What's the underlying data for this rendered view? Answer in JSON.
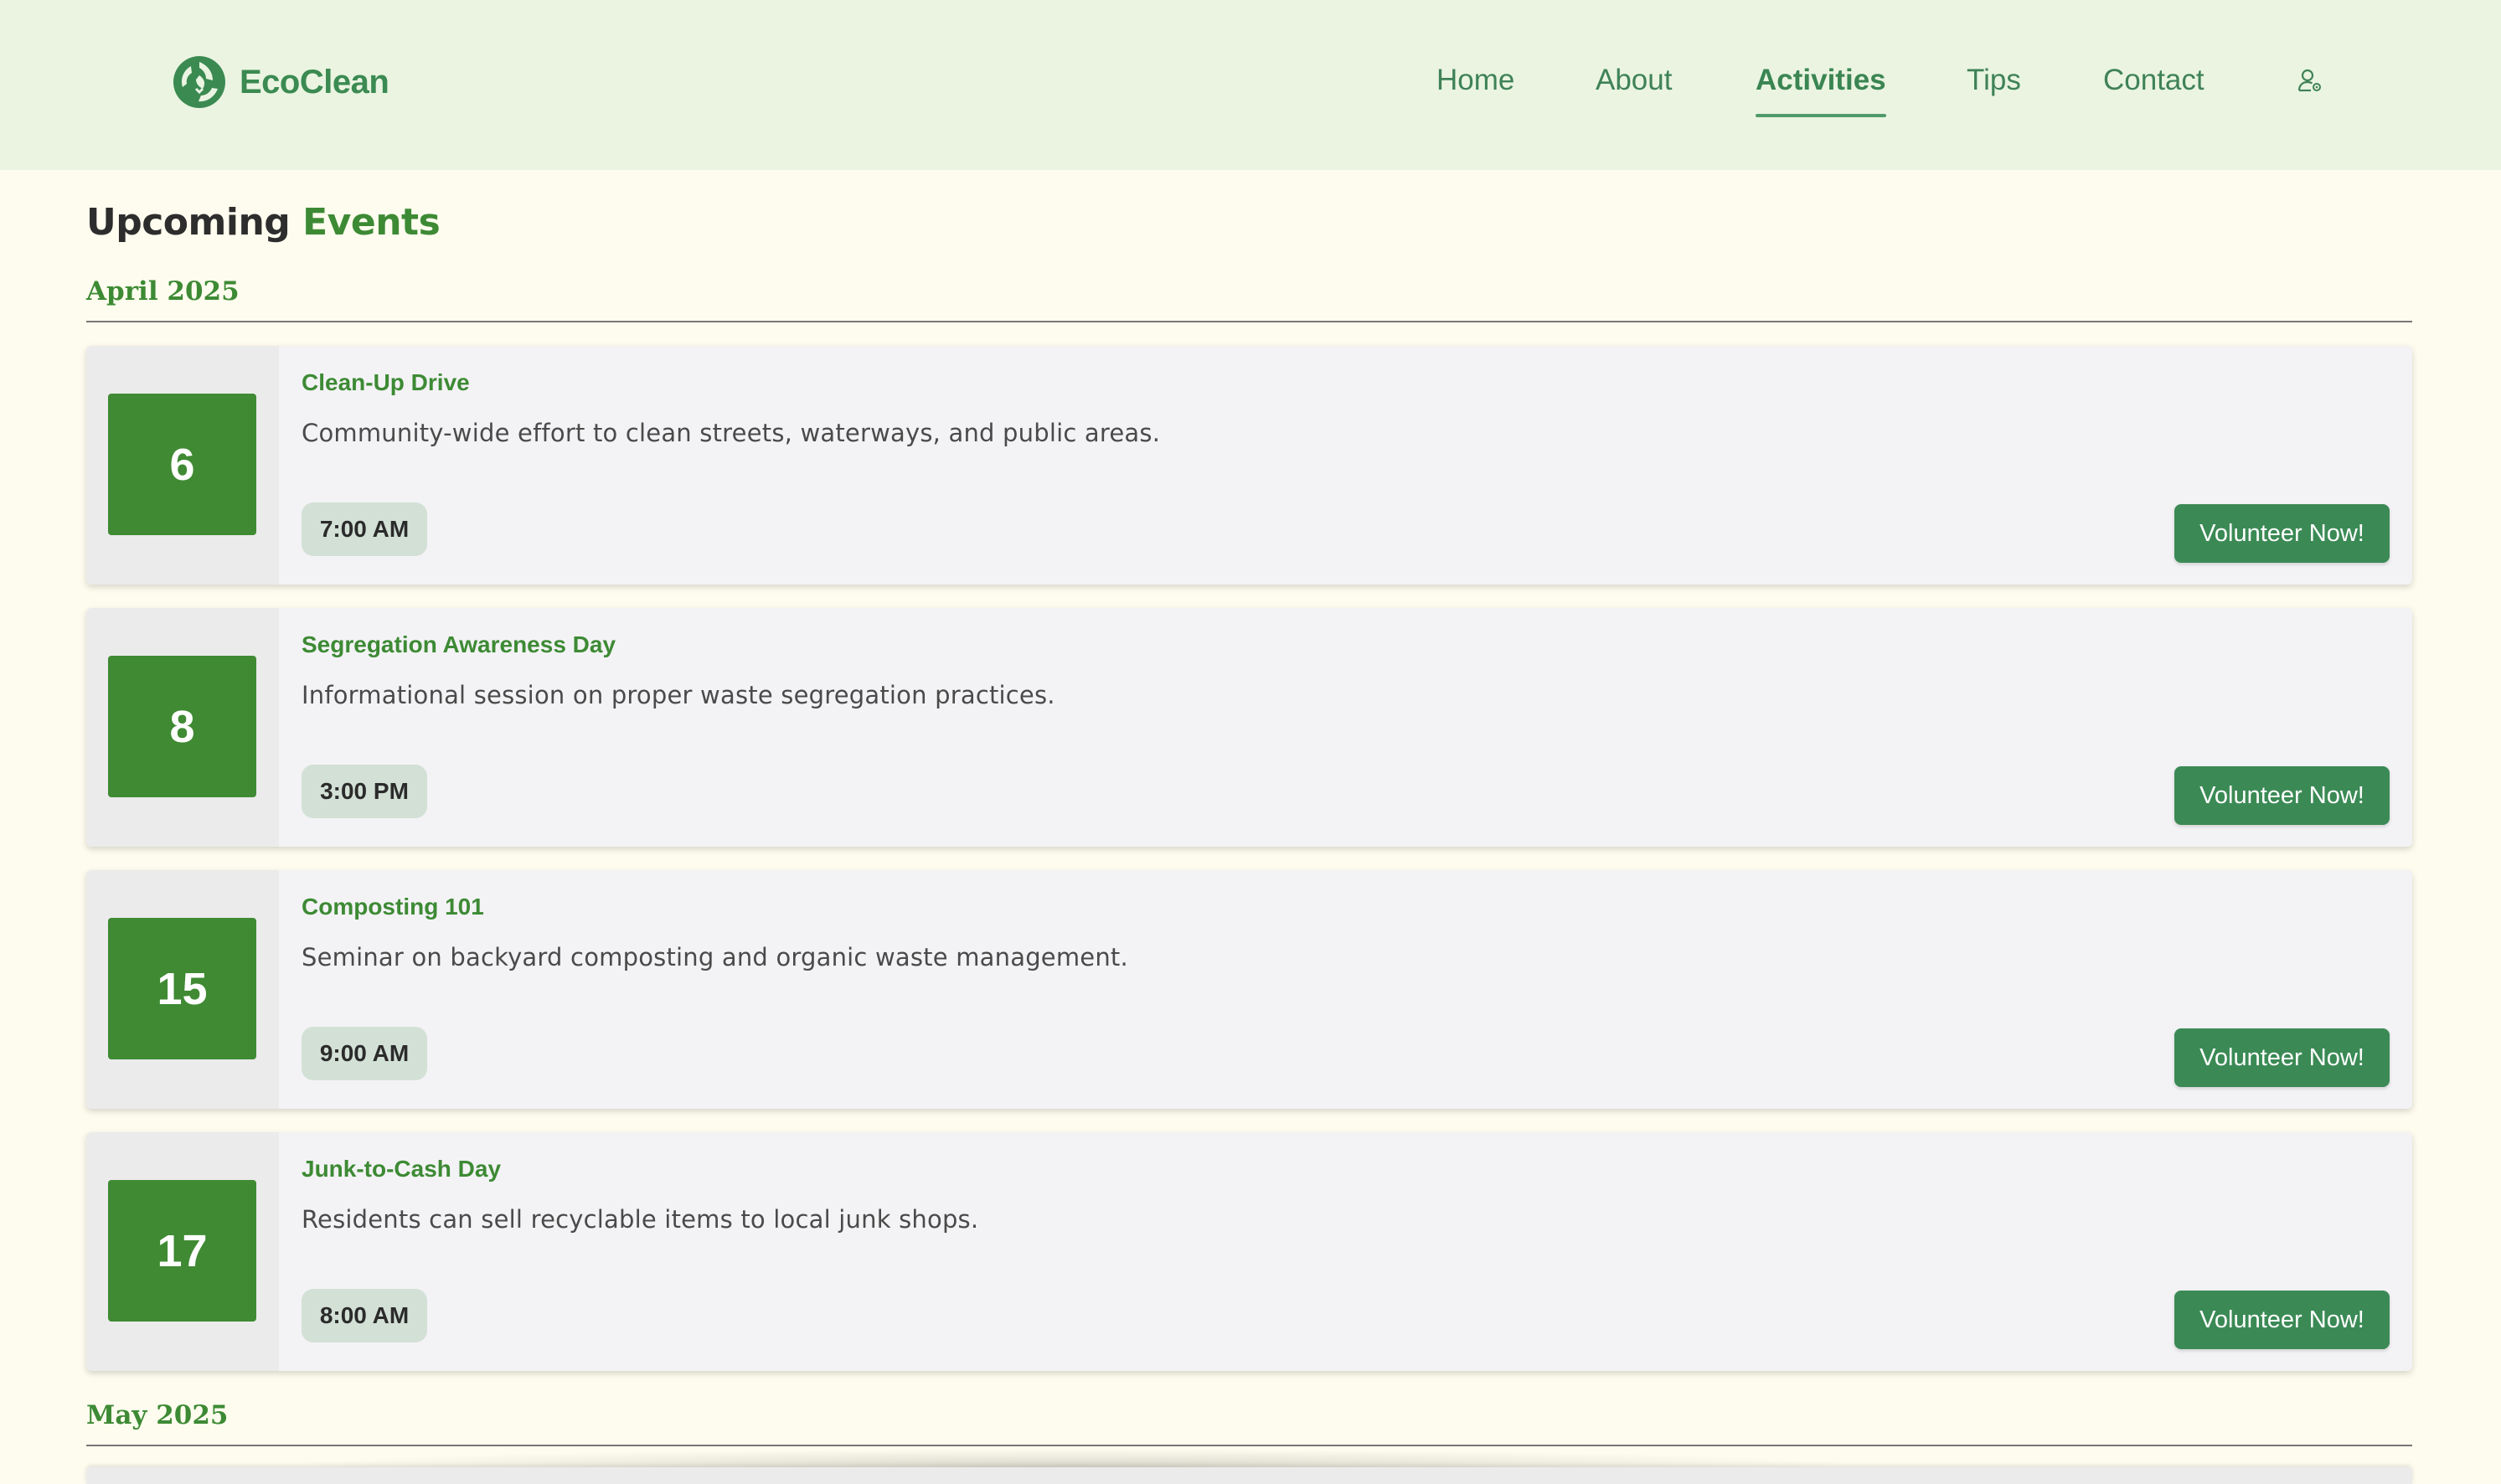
{
  "brand": {
    "name": "EcoClean",
    "logo_icon": "recycle-leaf-icon"
  },
  "nav": {
    "items": [
      {
        "label": "Home"
      },
      {
        "label": "About"
      },
      {
        "label": "Activities",
        "active": true
      },
      {
        "label": "Tips"
      },
      {
        "label": "Contact"
      }
    ],
    "user_icon": "user-gear-icon"
  },
  "page": {
    "title_part1": "Upcoming",
    "title_part2": "Events"
  },
  "months": [
    {
      "label": "April 2025",
      "events": [
        {
          "day": "6",
          "title": "Clean-Up Drive",
          "description": "Community-wide effort to clean streets, waterways, and public areas.",
          "time": "7:00 AM",
          "button": "Volunteer Now!"
        },
        {
          "day": "8",
          "title": "Segregation Awareness Day",
          "description": "Informational session on proper waste segregation practices.",
          "time": "3:00 PM",
          "button": "Volunteer Now!"
        },
        {
          "day": "15",
          "title": "Composting 101",
          "description": "Seminar on backyard composting and organic waste management.",
          "time": "9:00 AM",
          "button": "Volunteer Now!"
        },
        {
          "day": "17",
          "title": "Junk-to-Cash Day",
          "description": "Residents can sell recyclable items to local junk shops.",
          "time": "8:00 AM",
          "button": "Volunteer Now!"
        }
      ]
    },
    {
      "label": "May 2025",
      "events": []
    }
  ],
  "colors": {
    "header_bg": "#eaf4e1",
    "page_bg": "#fefcee",
    "accent_green": "#3d8a34",
    "button_green": "#3b8a55",
    "nav_text": "#3f8257"
  }
}
